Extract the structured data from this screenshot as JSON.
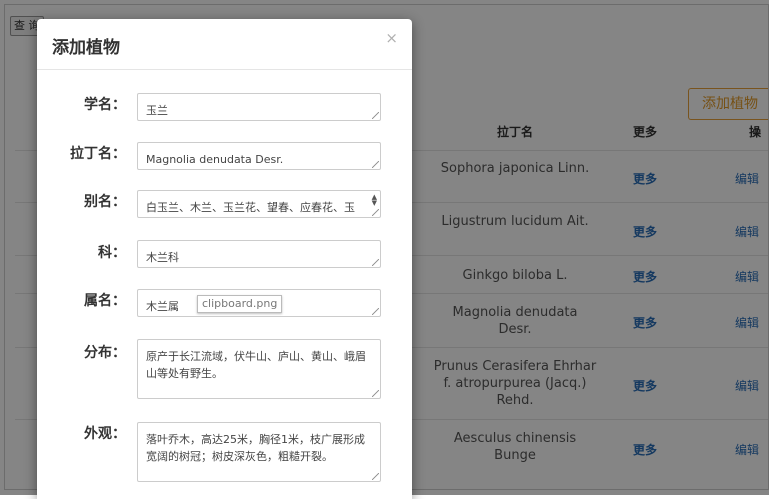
{
  "background": {
    "query_button": "查 询",
    "add_plant_button": "添加植物",
    "table": {
      "headers": {
        "latin": "拉丁名",
        "more": "更多",
        "actions": "操"
      },
      "rows": [
        {
          "latin": "Sophora japonica Linn.",
          "more": "更多",
          "edit": "编辑"
        },
        {
          "latin": "Ligustrum lucidum Ait.",
          "more": "更多",
          "edit": "编辑"
        },
        {
          "latin": "Ginkgo biloba L.",
          "more": "更多",
          "edit": "编辑"
        },
        {
          "latin": "Magnolia denudata Desr.",
          "more": "更多",
          "edit": "编辑"
        },
        {
          "latin": "Prunus Cerasifera Ehrhar f. atropurpurea (Jacq.) Rehd.",
          "more": "更多",
          "edit": "编辑"
        },
        {
          "latin": "Aesculus chinensis Bunge",
          "more": "更多",
          "edit": "编辑"
        }
      ]
    }
  },
  "modal": {
    "title": "添加植物",
    "close_symbol": "×",
    "fields": {
      "sci_name": {
        "label": "学名：",
        "value": "玉兰"
      },
      "latin_name": {
        "label": "拉丁名：",
        "value": "Magnolia denudata Desr."
      },
      "alias": {
        "label": "别名：",
        "value": "白玉兰、木兰、玉兰花、望春、应春花、玉堂春、迎春"
      },
      "family": {
        "label": "科：",
        "value": "木兰科"
      },
      "genus": {
        "label": "属名：",
        "value": "木兰属"
      },
      "distribution": {
        "label": "分布：",
        "value": "原产于长江流域，伏牛山、庐山、黄山、峨眉山等处有野生。"
      },
      "appearance": {
        "label": "外观：",
        "value": "落叶乔木，高达25米，胸径1米，枝广展形成宽阔的树冠；树皮深灰色，粗糙开裂。"
      }
    }
  },
  "tooltip": "clipboard.png"
}
